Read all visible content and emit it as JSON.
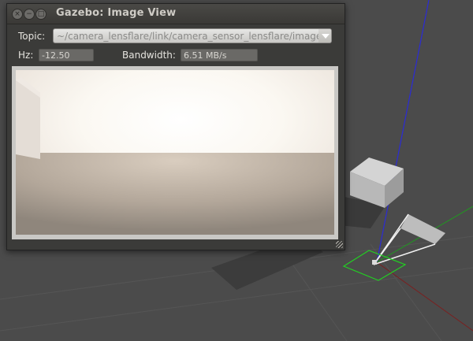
{
  "window": {
    "title": "Gazebo: Image View",
    "buttons": {
      "close": "×",
      "minimize": "−",
      "maximize": "□"
    }
  },
  "topic": {
    "label": "Topic:",
    "value": "~/camera_lensflare/link/camera_sensor_lensflare/image"
  },
  "stats": {
    "hz_label": "Hz:",
    "hz_value": "-12.50",
    "bandwidth_label": "Bandwidth:",
    "bandwidth_value": "6.51 MB/s"
  },
  "colors": {
    "background": "#4b4b4b",
    "window": "#3b3b39",
    "axis_z": "#2020c0",
    "axis_y": "#1f9a1f",
    "axis_x": "#a02020",
    "selection": "#22c022"
  }
}
